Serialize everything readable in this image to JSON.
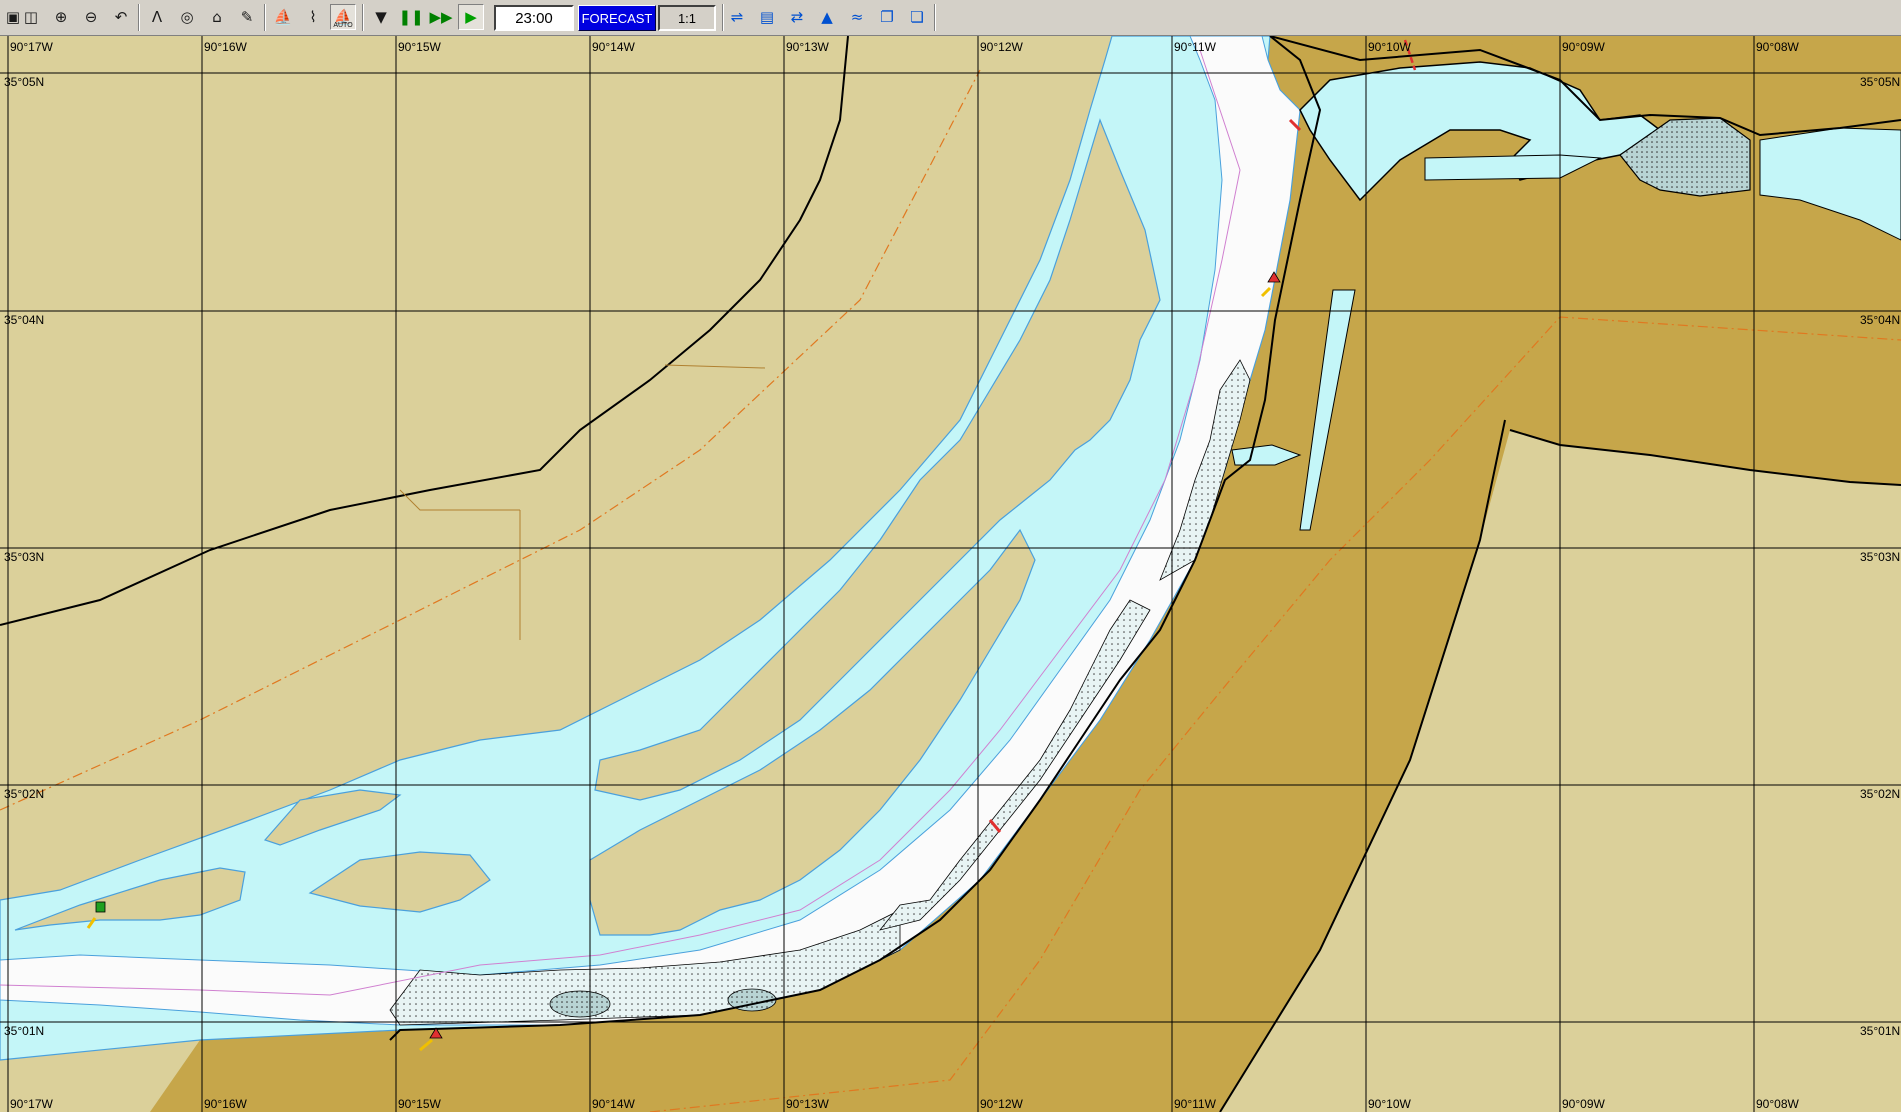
{
  "toolbar": {
    "buttons": [
      {
        "icon": "select-window-icon"
      },
      {
        "icon": "zoom-window-icon"
      },
      {
        "icon": "zoom-in-icon"
      },
      {
        "icon": "zoom-out-icon"
      },
      {
        "icon": "zoom-previous-icon"
      },
      {
        "icon": "measure-compass-icon"
      },
      {
        "icon": "target-icon"
      },
      {
        "icon": "route-add-icon"
      },
      {
        "icon": "route-edit-icon"
      },
      {
        "icon": "ship-icon"
      },
      {
        "icon": "ship-track-icon"
      },
      {
        "icon": "auto-ship-icon",
        "sub": "AUTO",
        "pressed": true
      },
      {
        "icon": "stop-icon"
      },
      {
        "icon": "pause-icon"
      },
      {
        "icon": "fast-forward-icon"
      },
      {
        "icon": "play-icon"
      },
      {
        "icon": "tide-current-icon"
      },
      {
        "icon": "chart-layer-icon"
      },
      {
        "icon": "waypoint-icon"
      },
      {
        "icon": "depth-icon"
      },
      {
        "icon": "wind-icon"
      },
      {
        "icon": "copy-icon"
      },
      {
        "icon": "window-icon"
      }
    ],
    "time": "23:00",
    "forecast_label": "FORECAST",
    "scale": "1:1"
  },
  "map": {
    "longitude_labels": [
      "90°17W",
      "90°16W",
      "90°15W",
      "90°14W",
      "90°13W",
      "90°12W",
      "90°11W",
      "90°10W",
      "90°09W",
      "90°08W"
    ],
    "latitude_labels": [
      "35°05N",
      "35°04N",
      "35°03N",
      "35°02N",
      "35°01N"
    ],
    "colors": {
      "land": "#dbd09a",
      "bank": "#c6a64a",
      "shallow_water": "#c4f6f8",
      "deep_water": "#fbfbfb",
      "grid": "#000000",
      "depth_contour": "#4aa0dc",
      "boundary_dashed": "#e07820"
    }
  }
}
